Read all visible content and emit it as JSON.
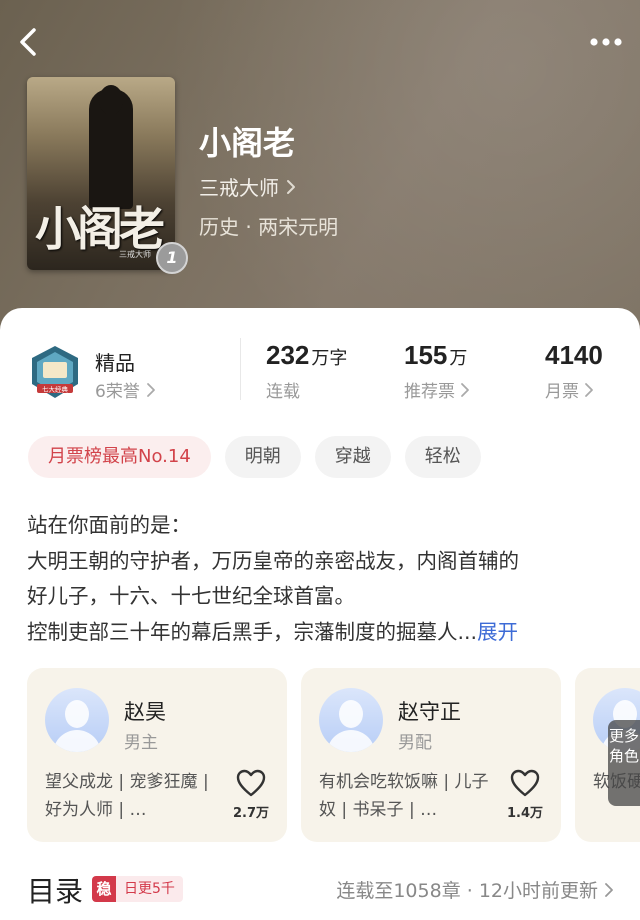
{
  "header": {
    "back_icon": "chevron-left-icon",
    "more_icon": "more-dots-icon"
  },
  "book": {
    "cover_title": "小阁老",
    "cover_author": "三戒大师",
    "cover_badge": "1",
    "title": "小阁老",
    "author": "三戒大师",
    "genre": "历史 · 两宋元明"
  },
  "stats": {
    "quality_label": "精品",
    "honor_text": "6荣誉",
    "emblem_text": "七大经典",
    "word_count": "232",
    "word_unit": "万字",
    "status": "连载",
    "rec_count": "155",
    "rec_unit": "万",
    "rec_label": "推荐票",
    "monthly_count": "4140",
    "monthly_label": "月票"
  },
  "tags": [
    "月票榜最高No.14",
    "明朝",
    "穿越",
    "轻松"
  ],
  "intro": {
    "lines": [
      "站在你面前的是：",
      "大明王朝的守护者，万历皇帝的亲密战友，内阁首辅的",
      "好儿子，十六、十七世纪全球首富。",
      "控制吏部三十年的幕后黑手，宗藩制度的掘墓人..."
    ],
    "expand_label": "展开"
  },
  "characters": [
    {
      "name": "赵昊",
      "role": "男主",
      "desc": "望父成龙 | 宠爹狂魔 | 好为人师 | …",
      "likes": "2.7万"
    },
    {
      "name": "赵守正",
      "role": "男配",
      "desc": "有机会吃软饭嘛 | 儿子奴 | 书呆子 | …",
      "likes": "1.4万"
    },
    {
      "name": "",
      "role": "",
      "desc": "软饭硬吃者 | 剧…",
      "likes": ""
    }
  ],
  "more_roles_label": "更多角色",
  "toc": {
    "title": "目录",
    "badge_stable": "稳",
    "badge_daily": "日更5千",
    "status": "连载至1058章 · 12小时前更新"
  },
  "colors": {
    "accent_red": "#d2434a",
    "link_blue": "#3d6bd6",
    "char_card_bg": "#f7f3ea"
  }
}
